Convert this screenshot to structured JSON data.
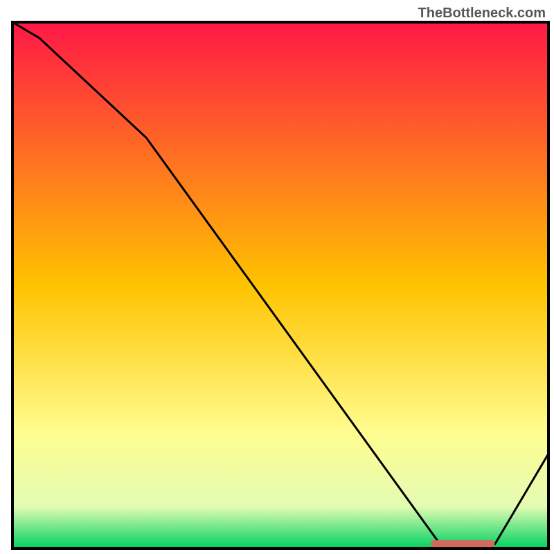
{
  "attribution": "TheBottleneck.com",
  "chart_data": {
    "type": "line",
    "title": "",
    "xlabel": "",
    "ylabel": "",
    "x": [
      0,
      5,
      25,
      80,
      82,
      90,
      100
    ],
    "values": [
      100,
      97,
      78,
      0.5,
      0.5,
      0.8,
      18
    ],
    "xlim": [
      0,
      100
    ],
    "ylim": [
      0,
      100
    ],
    "marker_segment": {
      "x_start": 78,
      "x_end": 90,
      "y": 0.9
    },
    "gradient_stops": [
      {
        "offset": 0,
        "color": "#ff1846"
      },
      {
        "offset": 50,
        "color": "#ffc300"
      },
      {
        "offset": 78,
        "color": "#fffd8f"
      },
      {
        "offset": 92,
        "color": "#e3fcb3"
      },
      {
        "offset": 100,
        "color": "#00d160"
      }
    ]
  },
  "colors": {
    "frame": "#000000",
    "curve": "#000000",
    "marker": "#d06a5e"
  }
}
